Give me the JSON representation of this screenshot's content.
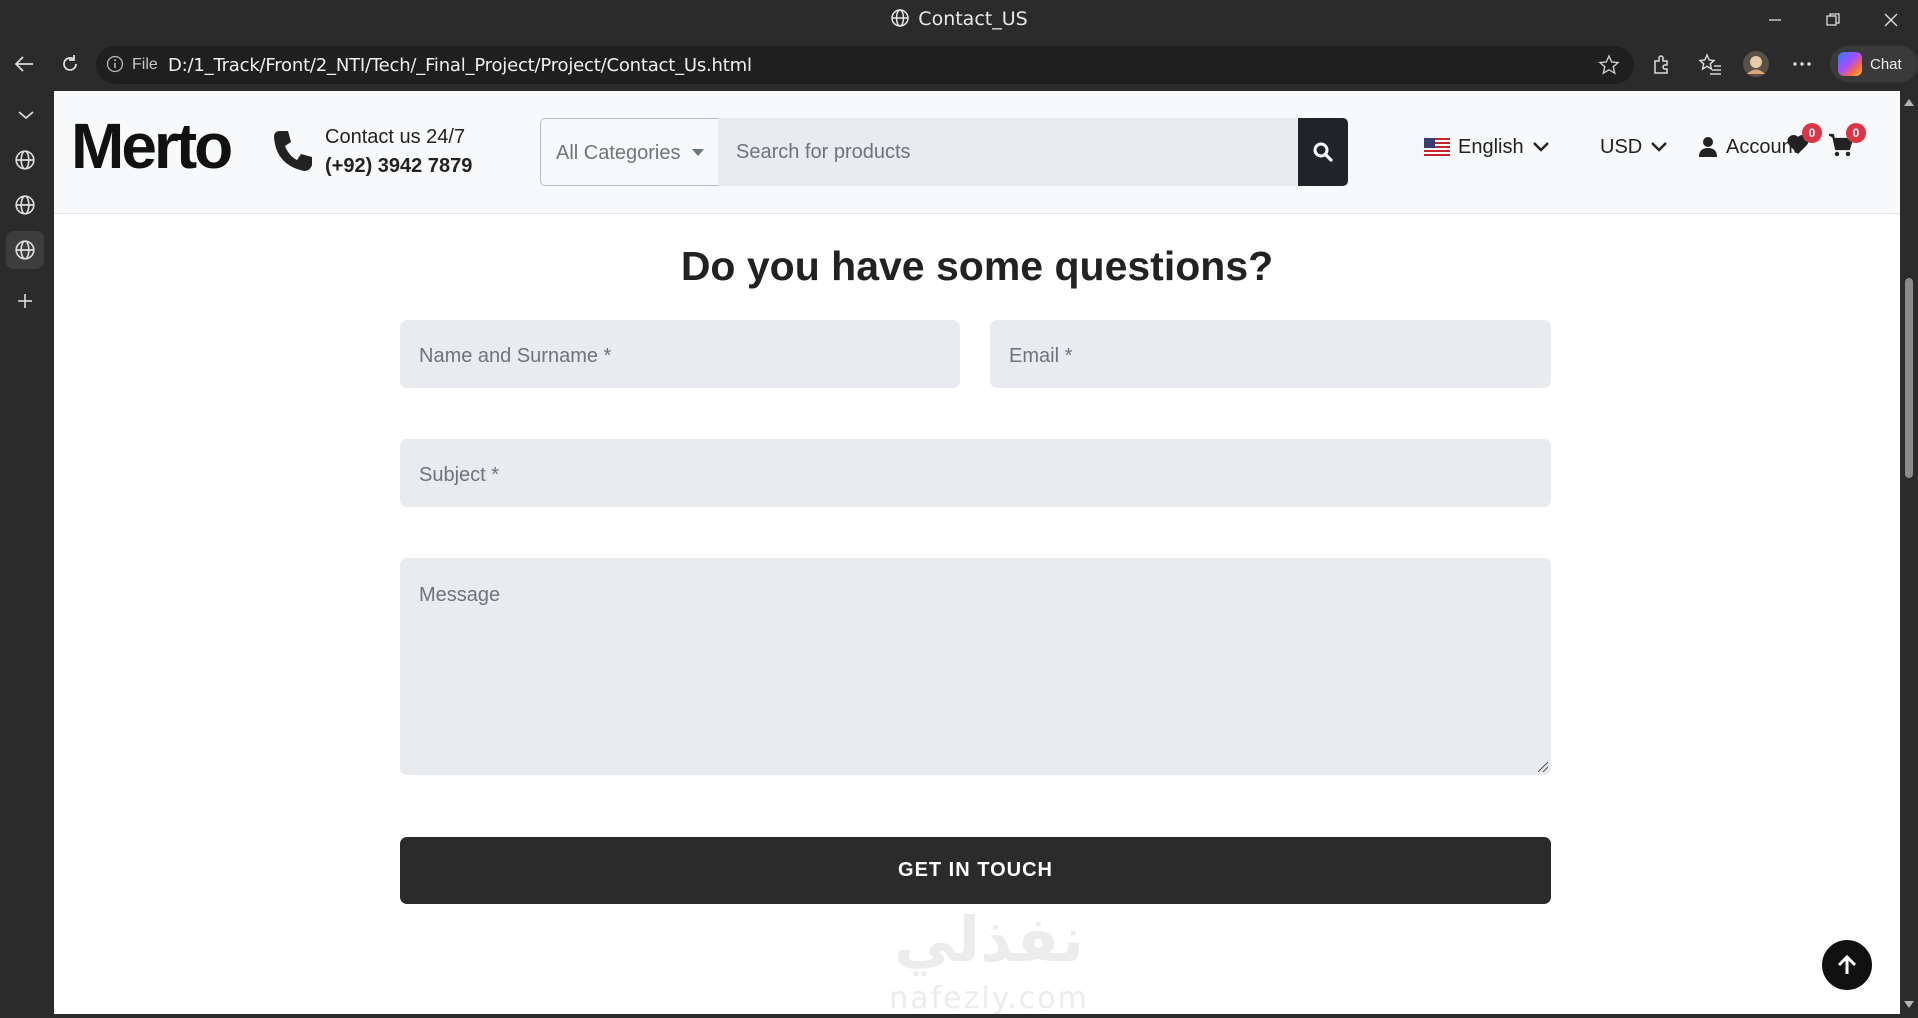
{
  "browser": {
    "window_title": "Contact_US",
    "url_prefix": "File",
    "url": "D:/1_Track/Front/2_NTI/Tech/_Final_Project/Project/Contact_Us.html",
    "chat_label": "Chat"
  },
  "header": {
    "logo_text": "Merto",
    "contact_label": "Contact us 24/7",
    "contact_phone": "(+92) 3942 7879",
    "category_select": "All Categories",
    "search_placeholder": "Search for products",
    "language": "English",
    "currency": "USD",
    "account_label": "Account",
    "wishlist_count": "0",
    "cart_count": "0"
  },
  "form": {
    "heading": "Do you have some questions?",
    "name_placeholder": "Name and Surname *",
    "email_placeholder": "Email *",
    "subject_placeholder": "Subject *",
    "message_placeholder": "Message",
    "submit_label": "GET IN TOUCH"
  },
  "watermark": {
    "arabic": "نفذلي",
    "latin": "nafezly.com"
  },
  "colors": {
    "brand_red": "#c8221d",
    "badge_red": "#dc3545",
    "dark_button": "#2b2b2b",
    "input_bg": "#e9ebef"
  },
  "icons": [
    "globe-icon",
    "back-arrow-icon",
    "reload-icon",
    "info-icon",
    "star-icon",
    "extensions-icon",
    "favorites-icon",
    "profile-avatar",
    "more-icon",
    "phone-icon",
    "search-icon",
    "chevron-down-icon",
    "user-icon",
    "heart-icon",
    "cart-icon",
    "arrow-up-icon",
    "plus-icon"
  ]
}
